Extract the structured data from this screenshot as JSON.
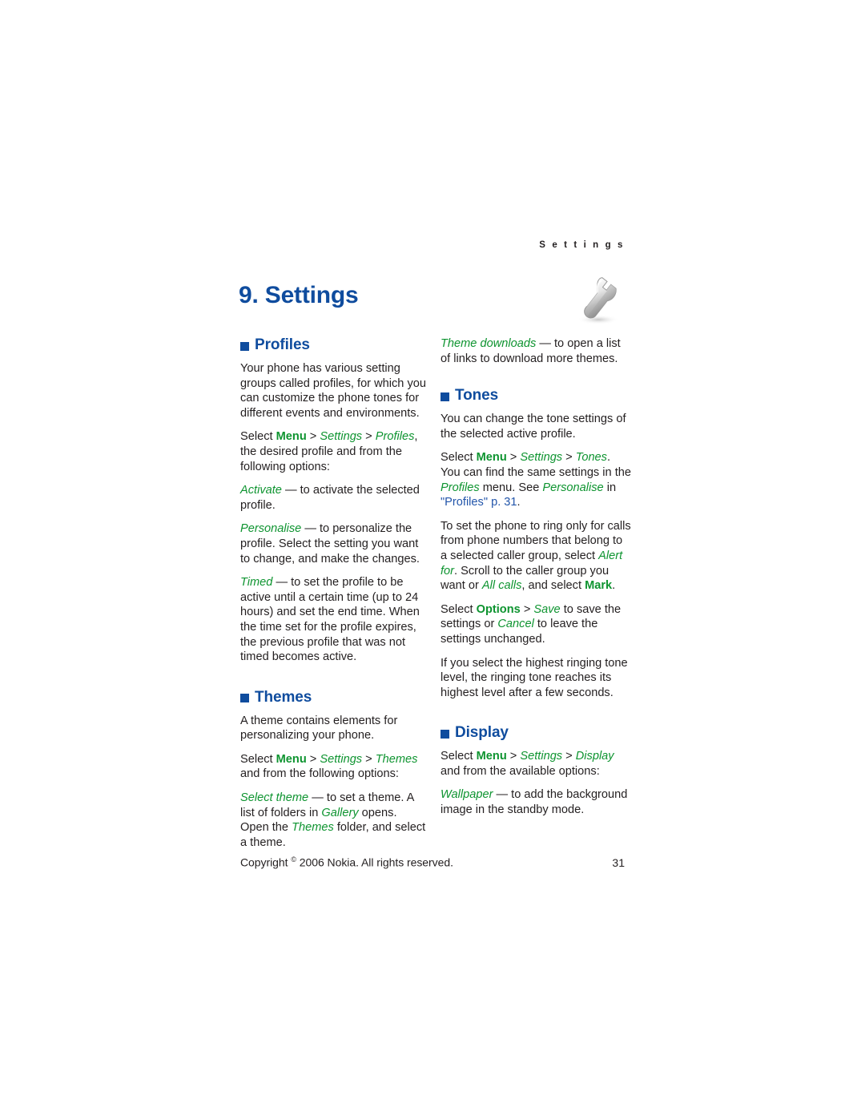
{
  "page": {
    "running_header": "S e t t i n g s",
    "chapter_title": "9. Settings",
    "icon_name": "wrench-icon"
  },
  "footer": {
    "copyright_prefix": "Copyright",
    "copyright_symbol": "©",
    "copyright_rest": "2006 Nokia. All rights reserved.",
    "page_number": "31"
  },
  "colors": {
    "heading_blue": "#0f4c9e",
    "link_blue": "#2255aa",
    "term_green": "#0e9430",
    "body_text": "#231f20",
    "page_background": "#ffffff"
  },
  "left_column": {
    "sections": [
      {
        "heading": "Profiles",
        "paragraphs": [
          {
            "runs": [
              {
                "text": "Your phone has various setting groups called profiles, for which you can customize the phone tones for different events and environments.",
                "style": "plain"
              }
            ]
          },
          {
            "runs": [
              {
                "text": "Select ",
                "style": "plain"
              },
              {
                "text": "Menu",
                "style": "green-bold"
              },
              {
                "text": " > ",
                "style": "plain"
              },
              {
                "text": "Settings",
                "style": "green-italic"
              },
              {
                "text": " > ",
                "style": "plain"
              },
              {
                "text": "Profiles",
                "style": "green-italic"
              },
              {
                "text": ", the desired profile and from the following options:",
                "style": "plain"
              }
            ]
          },
          {
            "runs": [
              {
                "text": "Activate",
                "style": "green-italic"
              },
              {
                "text": " — to activate the selected profile.",
                "style": "plain"
              }
            ]
          },
          {
            "runs": [
              {
                "text": "Personalise",
                "style": "green-italic"
              },
              {
                "text": " — to personalize the profile. Select the setting you want to change, and make the changes.",
                "style": "plain"
              }
            ]
          },
          {
            "runs": [
              {
                "text": "Timed",
                "style": "green-italic"
              },
              {
                "text": " — to set the profile to be active until a certain time (up to 24 hours) and set the end time. When the time set for the profile expires, the previous profile that was not timed becomes active.",
                "style": "plain"
              }
            ]
          }
        ]
      },
      {
        "heading": "Themes",
        "paragraphs": [
          {
            "runs": [
              {
                "text": "A theme contains elements for personalizing your phone.",
                "style": "plain"
              }
            ]
          },
          {
            "runs": [
              {
                "text": "Select ",
                "style": "plain"
              },
              {
                "text": "Menu",
                "style": "green-bold"
              },
              {
                "text": " > ",
                "style": "plain"
              },
              {
                "text": "Settings",
                "style": "green-italic"
              },
              {
                "text": " > ",
                "style": "plain"
              },
              {
                "text": "Themes",
                "style": "green-italic"
              },
              {
                "text": " and from the following options:",
                "style": "plain"
              }
            ]
          },
          {
            "runs": [
              {
                "text": "Select theme",
                "style": "green-italic"
              },
              {
                "text": " — to set a theme. A list of folders in ",
                "style": "plain"
              },
              {
                "text": "Gallery",
                "style": "green-italic"
              },
              {
                "text": " opens. Open the ",
                "style": "plain"
              },
              {
                "text": "Themes",
                "style": "green-italic"
              },
              {
                "text": " folder, and select a theme.",
                "style": "plain"
              }
            ]
          }
        ]
      }
    ]
  },
  "right_column": {
    "lead_paragraphs": [
      {
        "runs": [
          {
            "text": "Theme downloads",
            "style": "green-italic"
          },
          {
            "text": " — to open a list of links to download more themes.",
            "style": "plain"
          }
        ]
      }
    ],
    "sections": [
      {
        "heading": "Tones",
        "paragraphs": [
          {
            "runs": [
              {
                "text": "You can change the tone settings of the selected active profile.",
                "style": "plain"
              }
            ]
          },
          {
            "runs": [
              {
                "text": "Select ",
                "style": "plain"
              },
              {
                "text": "Menu",
                "style": "green-bold"
              },
              {
                "text": " > ",
                "style": "plain"
              },
              {
                "text": "Settings",
                "style": "green-italic"
              },
              {
                "text": " > ",
                "style": "plain"
              },
              {
                "text": "Tones",
                "style": "green-italic"
              },
              {
                "text": ". You can find the same settings in the ",
                "style": "plain"
              },
              {
                "text": "Profiles",
                "style": "green-italic"
              },
              {
                "text": " menu. See ",
                "style": "plain"
              },
              {
                "text": "Personalise",
                "style": "green-italic"
              },
              {
                "text": " in ",
                "style": "plain"
              },
              {
                "text": "\"Profiles\" p. 31",
                "style": "blue-link"
              },
              {
                "text": ".",
                "style": "plain"
              }
            ]
          },
          {
            "runs": [
              {
                "text": "To set the phone to ring only for calls from phone numbers that belong to a selected caller group, select ",
                "style": "plain"
              },
              {
                "text": "Alert for",
                "style": "green-italic"
              },
              {
                "text": ". Scroll to the caller group you want or ",
                "style": "plain"
              },
              {
                "text": "All calls",
                "style": "green-italic"
              },
              {
                "text": ", and select ",
                "style": "plain"
              },
              {
                "text": "Mark",
                "style": "green-bold"
              },
              {
                "text": ".",
                "style": "plain"
              }
            ]
          },
          {
            "runs": [
              {
                "text": "Select ",
                "style": "plain"
              },
              {
                "text": "Options",
                "style": "green-bold"
              },
              {
                "text": " > ",
                "style": "plain"
              },
              {
                "text": "Save",
                "style": "green-italic"
              },
              {
                "text": " to save the settings or ",
                "style": "plain"
              },
              {
                "text": "Cancel",
                "style": "green-italic"
              },
              {
                "text": " to leave the settings unchanged.",
                "style": "plain"
              }
            ]
          },
          {
            "runs": [
              {
                "text": "If you select the highest ringing tone level, the ringing tone reaches its highest level after a few seconds.",
                "style": "plain"
              }
            ]
          }
        ]
      },
      {
        "heading": "Display",
        "paragraphs": [
          {
            "runs": [
              {
                "text": "Select ",
                "style": "plain"
              },
              {
                "text": "Menu",
                "style": "green-bold"
              },
              {
                "text": " > ",
                "style": "plain"
              },
              {
                "text": "Settings",
                "style": "green-italic"
              },
              {
                "text": " > ",
                "style": "plain"
              },
              {
                "text": "Display",
                "style": "green-italic"
              },
              {
                "text": " and from the available options:",
                "style": "plain"
              }
            ]
          },
          {
            "runs": [
              {
                "text": "Wallpaper",
                "style": "green-italic"
              },
              {
                "text": " — to add the background image in the standby mode.",
                "style": "plain"
              }
            ]
          }
        ]
      }
    ]
  }
}
